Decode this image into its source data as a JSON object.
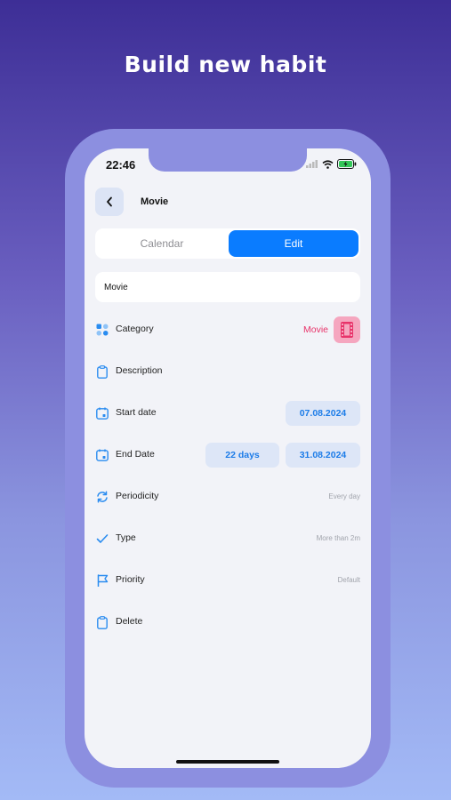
{
  "promo": {
    "headline": "Build new habit"
  },
  "status_bar": {
    "time": "22:46"
  },
  "header": {
    "title": "Movie"
  },
  "tabs": [
    {
      "label": "Calendar",
      "selected": false
    },
    {
      "label": "Edit",
      "selected": true
    }
  ],
  "name_field": {
    "value": "Movie"
  },
  "rows": {
    "category": {
      "label": "Category",
      "value": "Movie"
    },
    "description": {
      "label": "Description"
    },
    "start_date": {
      "label": "Start date",
      "value": "07.08.2024"
    },
    "end_date": {
      "label": "End Date",
      "duration": "22 days",
      "value": "31.08.2024"
    },
    "periodicity": {
      "label": "Periodicity",
      "value": "Every day"
    },
    "type": {
      "label": "Type",
      "value": "More than 2m"
    },
    "priority": {
      "label": "Priority",
      "value": "Default"
    },
    "delete": {
      "label": "Delete"
    }
  },
  "colors": {
    "accent": "#0a7cff",
    "category": "#e8336a",
    "pill_bg": "#dde6f7"
  }
}
